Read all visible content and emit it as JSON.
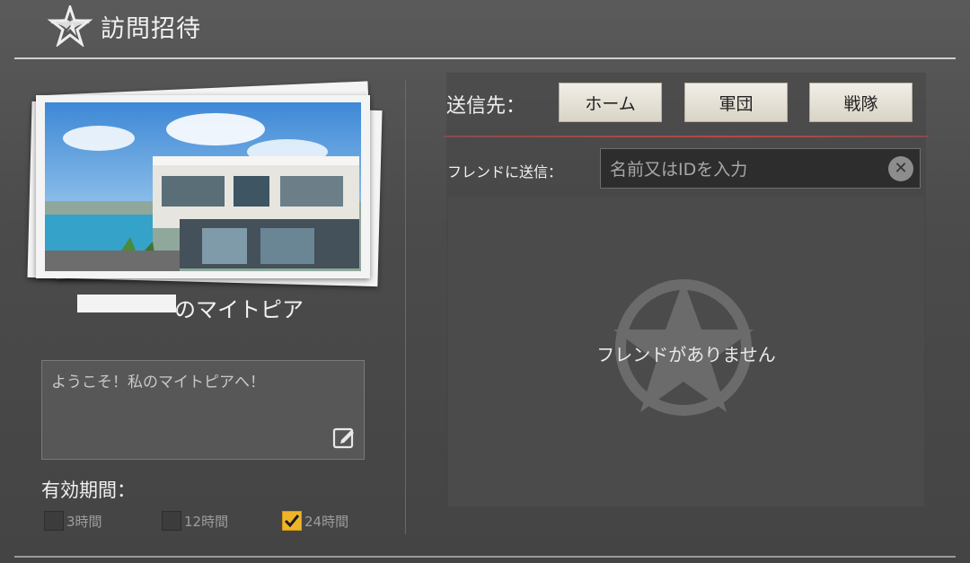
{
  "header": {
    "title": "訪問招待",
    "logo_icon": "star-emblem-icon"
  },
  "left": {
    "owner_suffix": "のマイトピア",
    "message_text": "ようこそ！私のマイトピアへ！",
    "edit_icon": "edit-icon",
    "validity": {
      "label": "有効期間：",
      "options": [
        {
          "label": "3時間",
          "checked": false
        },
        {
          "label": "12時間",
          "checked": false
        },
        {
          "label": "24時間",
          "checked": true
        }
      ]
    }
  },
  "right": {
    "send_label": "送信先：",
    "destinations": [
      "ホーム",
      "軍団",
      "戦隊"
    ],
    "friend_label": "フレンドに送信：",
    "search_placeholder": "名前又はIDを入力",
    "clear_icon": "clear-icon",
    "empty_text": "フレンドがありません"
  },
  "colors": {
    "check": "#f0b429",
    "accent_line": "#b54848"
  }
}
